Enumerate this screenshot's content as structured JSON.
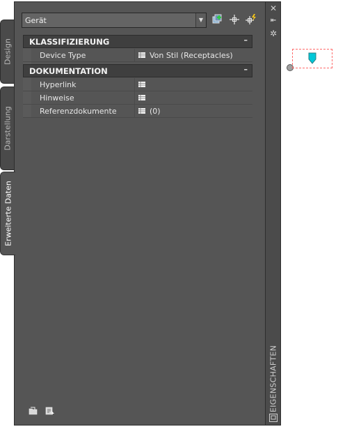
{
  "tabs": [
    {
      "label": "Design",
      "active": false
    },
    {
      "label": "Darstellung",
      "active": false
    },
    {
      "label": "Erweiterte Daten",
      "active": true
    }
  ],
  "dropdown": {
    "value": "Gerät"
  },
  "categories": [
    {
      "title": "KLASSIFIZIERUNG",
      "rows": [
        {
          "label": "Device Type",
          "value": "Von Stil (Receptacles)"
        }
      ]
    },
    {
      "title": "DOKUMENTATION",
      "rows": [
        {
          "label": "Hyperlink",
          "value": ""
        },
        {
          "label": "Hinweise",
          "value": ""
        },
        {
          "label": "Referenzdokumente",
          "value": "(0)"
        }
      ]
    }
  ],
  "collapse_symbol": "–",
  "palette_title": "EIGENSCHAFTEN",
  "titlebar_buttons": {
    "close": "✕",
    "autohide": "⇤",
    "properties": "✲"
  },
  "colors": {
    "accent_cyan": "#00c8d8",
    "preview_dash": "#ff6a6a",
    "palette_bg": "#555555"
  }
}
